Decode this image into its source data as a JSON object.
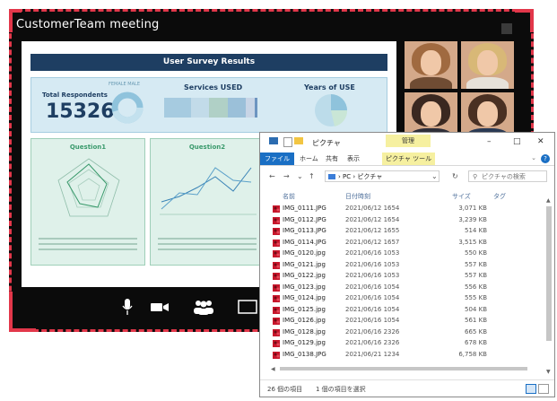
{
  "meeting": {
    "title": "CustomerTeam meeting",
    "colors": {
      "background": "#0b0b0b",
      "selection": "#e2374a"
    }
  },
  "slide": {
    "banner": "User Survey Results",
    "total_label": "Total Respondents",
    "total_value": "15326",
    "legend_text": "FEMALE MALE",
    "services_label": "Services USED",
    "years_label": "Years of USE",
    "q1_title": "Question1",
    "q2_title": "Question2"
  },
  "toolbar": {
    "icons": [
      "microphone-icon",
      "video-camera-icon",
      "participants-icon",
      "share-screen-icon"
    ]
  },
  "explorer": {
    "window_title": "ピクチャ",
    "mgmt_tab": "管理",
    "ribbon": {
      "file": "ファイル",
      "home": "ホーム",
      "share": "共有",
      "view": "表示",
      "tools": "ピクチャ ツール"
    },
    "address": {
      "pc": "PC",
      "folder": "ピクチャ"
    },
    "search_placeholder": "ピクチャの検索",
    "columns": {
      "name": "名前",
      "date": "日付時刻",
      "size": "サイズ",
      "tag": "タグ"
    },
    "files": [
      {
        "name": "IMG_0111.JPG",
        "date": "2021/06/12 1654",
        "size": "3,071 KB"
      },
      {
        "name": "IMG_0112.JPG",
        "date": "2021/06/12 1654",
        "size": "3,239 KB"
      },
      {
        "name": "IMG_0113.JPG",
        "date": "2021/06/12 1655",
        "size": "514 KB"
      },
      {
        "name": "IMG_0114.JPG",
        "date": "2021/06/12 1657",
        "size": "3,515 KB"
      },
      {
        "name": "IMG_0120.jpg",
        "date": "2021/06/16 1053",
        "size": "550 KB"
      },
      {
        "name": "IMG_0121.jpg",
        "date": "2021/06/16 1053",
        "size": "557 KB"
      },
      {
        "name": "IMG_0122.jpg",
        "date": "2021/06/16 1053",
        "size": "557 KB"
      },
      {
        "name": "IMG_0123.jpg",
        "date": "2021/06/16 1054",
        "size": "556 KB"
      },
      {
        "name": "IMG_0124.jpg",
        "date": "2021/06/16 1054",
        "size": "555 KB"
      },
      {
        "name": "IMG_0125.jpg",
        "date": "2021/06/16 1054",
        "size": "504 KB"
      },
      {
        "name": "IMG_0126.jpg",
        "date": "2021/06/16 1054",
        "size": "561 KB"
      },
      {
        "name": "IMG_0128.jpg",
        "date": "2021/06/16 2326",
        "size": "665 KB"
      },
      {
        "name": "IMG_0129.jpg",
        "date": "2021/06/16 2326",
        "size": "678 KB"
      },
      {
        "name": "IMG_0138.JPG",
        "date": "2021/06/21 1234",
        "size": "6,758 KB"
      }
    ],
    "status": {
      "count": "26 個の項目",
      "selected": "1 個の項目を選択"
    }
  }
}
